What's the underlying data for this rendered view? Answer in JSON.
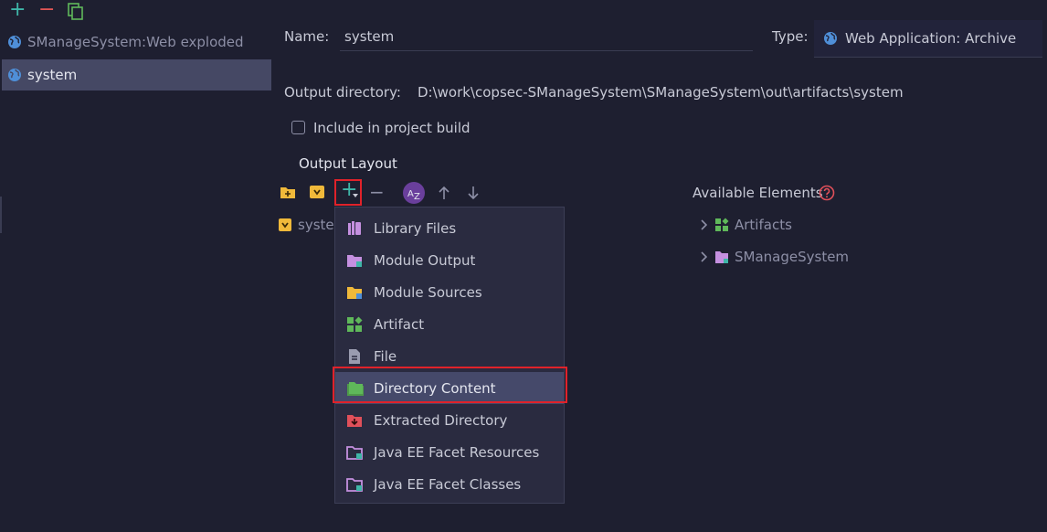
{
  "toolbar": {
    "add_label": "+",
    "remove_label": "−"
  },
  "artifacts_list": [
    {
      "label": "SManageSystem:Web exploded",
      "selected": false
    },
    {
      "label": "system",
      "selected": true
    }
  ],
  "form": {
    "name_label": "Name:",
    "name_value": "system",
    "type_label": "Type:",
    "type_value": "Web Application: Archive",
    "output_dir_label": "Output directory:",
    "output_dir_value": "D:\\work\\copsec-SManageSystem\\SManageSystem\\out\\artifacts\\system",
    "include_label": "Include in project build",
    "include_checked": false
  },
  "output_layout": {
    "title": "Output Layout",
    "tree_root": "system"
  },
  "available_elements": {
    "title": "Available Elements",
    "items": [
      {
        "label": "Artifacts",
        "icon": "artifact-icon"
      },
      {
        "label": "SManageSystem",
        "icon": "module-folder-icon"
      }
    ]
  },
  "add_menu": {
    "items": [
      {
        "label": "Library Files",
        "icon": "library-icon"
      },
      {
        "label": "Module Output",
        "icon": "module-output-icon"
      },
      {
        "label": "Module Sources",
        "icon": "module-sources-icon"
      },
      {
        "label": "Artifact",
        "icon": "artifact-icon"
      },
      {
        "label": "File",
        "icon": "file-icon"
      },
      {
        "label": "Directory Content",
        "icon": "directory-content-icon",
        "highlighted": true
      },
      {
        "label": "Extracted Directory",
        "icon": "extracted-directory-icon"
      },
      {
        "label": "Java EE Facet Resources",
        "icon": "facet-resources-icon"
      },
      {
        "label": "Java EE Facet Classes",
        "icon": "facet-classes-icon"
      }
    ]
  },
  "colors": {
    "background": "#1e1f30",
    "selection": "#454864",
    "menu_background": "#2a2b40",
    "highlight_border": "#e0222a",
    "add_green": "#3fb6a8",
    "remove_red": "#e05555"
  }
}
